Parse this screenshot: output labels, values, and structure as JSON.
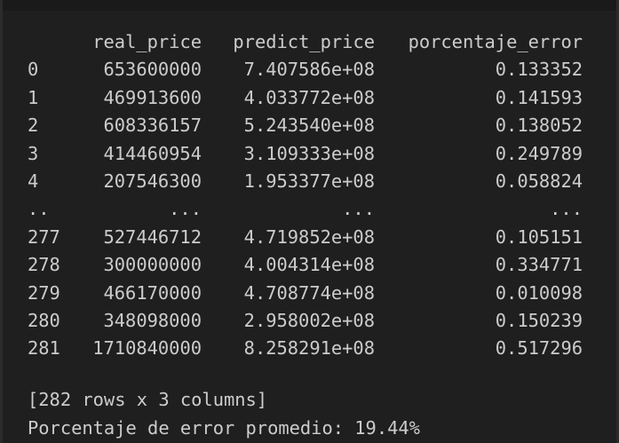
{
  "columns": {
    "index": "",
    "real_price": "real_price",
    "predict_price": "predict_price",
    "porcentaje_error": "porcentaje_error"
  },
  "rows": [
    {
      "index": "0",
      "real_price": "653600000",
      "predict_price": "7.407586e+08",
      "porcentaje_error": "0.133352"
    },
    {
      "index": "1",
      "real_price": "469913600",
      "predict_price": "4.033772e+08",
      "porcentaje_error": "0.141593"
    },
    {
      "index": "2",
      "real_price": "608336157",
      "predict_price": "5.243540e+08",
      "porcentaje_error": "0.138052"
    },
    {
      "index": "3",
      "real_price": "414460954",
      "predict_price": "3.109333e+08",
      "porcentaje_error": "0.249789"
    },
    {
      "index": "4",
      "real_price": "207546300",
      "predict_price": "1.953377e+08",
      "porcentaje_error": "0.058824"
    },
    {
      "index": "..",
      "real_price": "...",
      "predict_price": "...",
      "porcentaje_error": "..."
    },
    {
      "index": "277",
      "real_price": "527446712",
      "predict_price": "4.719852e+08",
      "porcentaje_error": "0.105151"
    },
    {
      "index": "278",
      "real_price": "300000000",
      "predict_price": "4.004314e+08",
      "porcentaje_error": "0.334771"
    },
    {
      "index": "279",
      "real_price": "466170000",
      "predict_price": "4.708774e+08",
      "porcentaje_error": "0.010098"
    },
    {
      "index": "280",
      "real_price": "348098000",
      "predict_price": "2.958002e+08",
      "porcentaje_error": "0.150239"
    },
    {
      "index": "281",
      "real_price": "1710840000",
      "predict_price": "8.258291e+08",
      "porcentaje_error": "0.517296"
    }
  ],
  "summary": {
    "shape": "[282 rows x 3 columns]",
    "mean_error": "Porcentaje de error promedio: 19.44%"
  },
  "colors": {
    "background": "#1f1f1f",
    "text": "#cccccc"
  }
}
